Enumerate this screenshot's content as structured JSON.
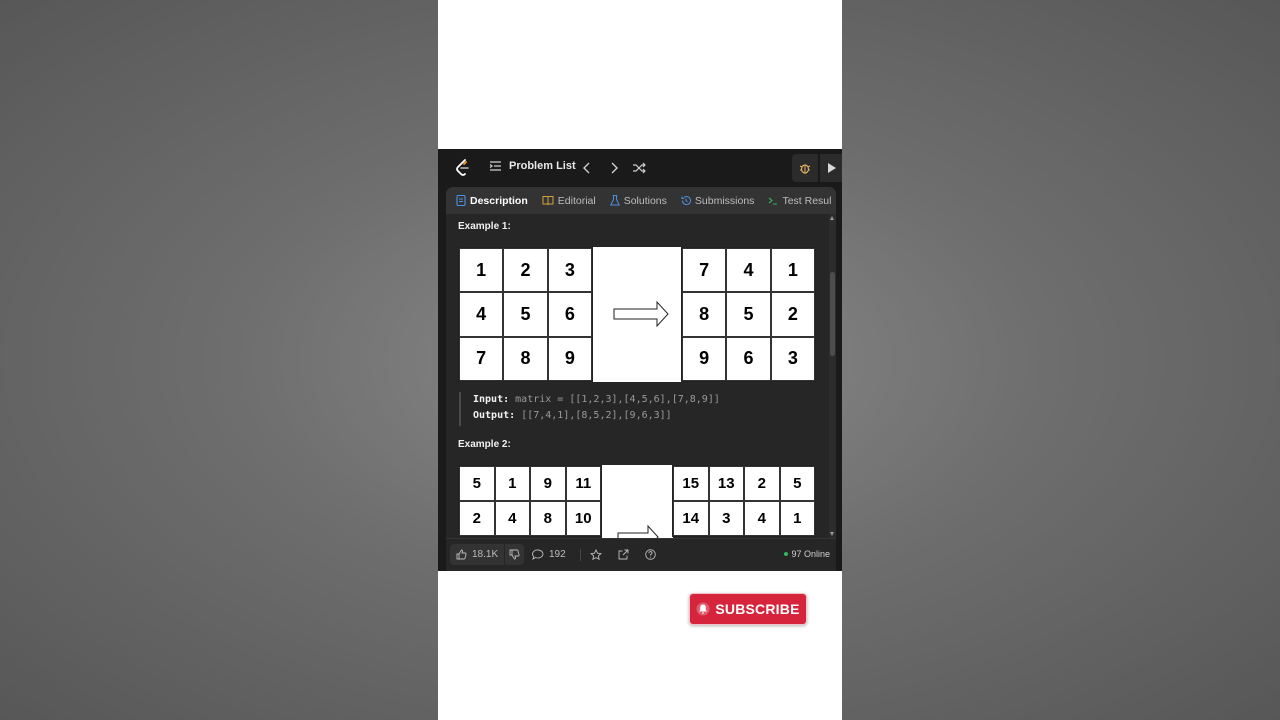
{
  "topbar": {
    "problem_list_label": "Problem List"
  },
  "tabs": [
    {
      "label": "Description",
      "icon": "document-icon",
      "active": true
    },
    {
      "label": "Editorial",
      "icon": "book-icon",
      "active": false
    },
    {
      "label": "Solutions",
      "icon": "flask-icon",
      "active": false
    },
    {
      "label": "Submissions",
      "icon": "history-icon",
      "active": false
    },
    {
      "label": "Test Resul",
      "icon": "terminal-icon",
      "active": false
    }
  ],
  "example1": {
    "title": "Example 1:",
    "input_matrix": [
      [
        "1",
        "2",
        "3"
      ],
      [
        "4",
        "5",
        "6"
      ],
      [
        "7",
        "8",
        "9"
      ]
    ],
    "output_matrix": [
      [
        "7",
        "4",
        "1"
      ],
      [
        "8",
        "5",
        "2"
      ],
      [
        "9",
        "6",
        "3"
      ]
    ],
    "input_label": "Input:",
    "input_value": "matrix = [[1,2,3],[4,5,6],[7,8,9]]",
    "output_label": "Output:",
    "output_value": "[[7,4,1],[8,5,2],[9,6,3]]"
  },
  "example2": {
    "title": "Example 2:",
    "input_matrix": [
      [
        "5",
        "1",
        "9",
        "11"
      ],
      [
        "2",
        "4",
        "8",
        "10"
      ]
    ],
    "output_matrix": [
      [
        "15",
        "13",
        "2",
        "5"
      ],
      [
        "14",
        "3",
        "4",
        "1"
      ]
    ]
  },
  "footer": {
    "likes": "18.1K",
    "comments": "192",
    "online": "97 Online"
  },
  "subscribe_label": "SUBSCRIBE",
  "colors": {
    "accent_green": "#2cbb5d",
    "subscribe_red": "#d6243d",
    "active_tab_icon": "#4a90e2"
  }
}
